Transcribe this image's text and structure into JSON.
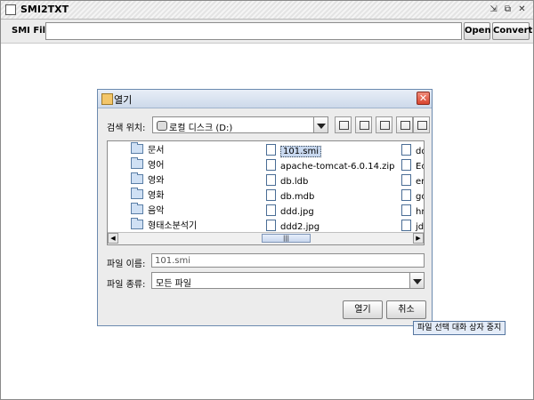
{
  "window": {
    "title": "SMI2TXT"
  },
  "toolbar": {
    "smi_label": "SMI File :",
    "smi_value": "",
    "open_label": "Open",
    "convert_label": "Convert"
  },
  "dialog": {
    "title": "열기",
    "look_in_label": "검색 위치:",
    "look_in_value": "로컬 디스크 (D:)",
    "icons": [
      "up-folder-icon",
      "home-icon",
      "new-folder-icon",
      "list-view-icon",
      "details-view-icon"
    ],
    "files": {
      "column1": [
        "문서",
        "영어",
        "영와",
        "영화",
        "음악",
        "형태소분석기"
      ],
      "column2": [
        "101.smi",
        "apache-tomcat-6.0.14.zip",
        "db.ldb",
        "db.mdb",
        "ddd.jpg",
        "ddd2.jpg"
      ],
      "column3": [
        "ddd",
        "Ecl",
        "erri",
        "goo",
        "hr.:",
        "jdk"
      ]
    },
    "file_name_label": "파일 이름:",
    "file_name_value": "101.smi",
    "file_type_label": "파일 종류:",
    "file_type_value": "모든 파일",
    "open_label": "열기",
    "cancel_label": "취소",
    "tooltip": "파일 선택 대화 상자 중지"
  }
}
